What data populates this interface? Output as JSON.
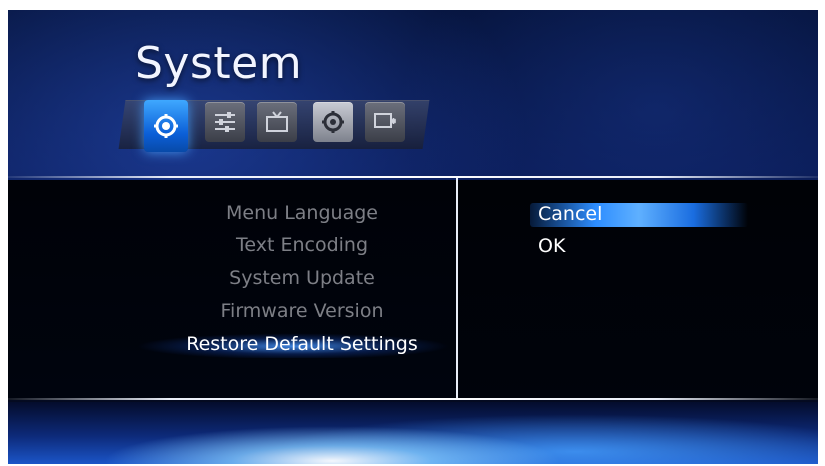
{
  "header": {
    "title": "System",
    "icons": [
      {
        "name": "system-gear-icon",
        "selected": true
      },
      {
        "name": "settings-sliders-icon",
        "selected": false
      },
      {
        "name": "tv-icon",
        "selected": false
      },
      {
        "name": "gear-icon",
        "selected": false
      },
      {
        "name": "display-sparkle-icon",
        "selected": false
      }
    ]
  },
  "menu": {
    "items": [
      "Menu Language",
      "Text Encoding",
      "System Update",
      "Firmware Version",
      "Restore Default Settings"
    ],
    "selected_index": 4
  },
  "options": {
    "items": [
      "Cancel",
      "OK"
    ],
    "selected_index": 0
  },
  "colors": {
    "accent": "#2d8dff",
    "inactive_text": "#7d7f86",
    "active_text": "#ffffff"
  }
}
